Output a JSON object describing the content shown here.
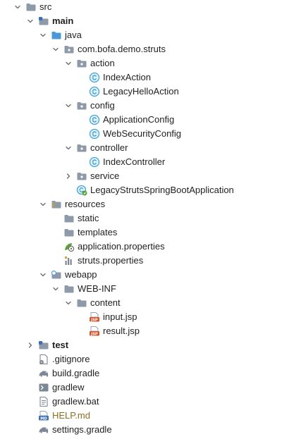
{
  "tree": {
    "items": [
      {
        "label": "src",
        "depth": 0,
        "icon": "folder-icon",
        "chevron": "down"
      },
      {
        "label": "main",
        "depth": 1,
        "icon": "module-folder-icon",
        "chevron": "down",
        "bold": true
      },
      {
        "label": "java",
        "depth": 2,
        "icon": "source-folder-icon",
        "chevron": "down"
      },
      {
        "label": "com.bofa.demo.struts",
        "depth": 3,
        "icon": "package-icon",
        "chevron": "down"
      },
      {
        "label": "action",
        "depth": 4,
        "icon": "package-icon",
        "chevron": "down"
      },
      {
        "label": "IndexAction",
        "depth": 5,
        "icon": "java-class-icon",
        "chevron": "none"
      },
      {
        "label": "LegacyHelloAction",
        "depth": 5,
        "icon": "java-class-icon",
        "chevron": "none"
      },
      {
        "label": "config",
        "depth": 4,
        "icon": "package-icon",
        "chevron": "down"
      },
      {
        "label": "ApplicationConfig",
        "depth": 5,
        "icon": "java-class-icon",
        "chevron": "none"
      },
      {
        "label": "WebSecurityConfig",
        "depth": 5,
        "icon": "java-class-icon",
        "chevron": "none"
      },
      {
        "label": "controller",
        "depth": 4,
        "icon": "package-icon",
        "chevron": "down"
      },
      {
        "label": "IndexController",
        "depth": 5,
        "icon": "java-class-icon",
        "chevron": "none"
      },
      {
        "label": "service",
        "depth": 4,
        "icon": "package-icon",
        "chevron": "right"
      },
      {
        "label": "LegacyStrutsSpringBootApplication",
        "depth": 4,
        "icon": "spring-boot-class-icon",
        "chevron": "none"
      },
      {
        "label": "resources",
        "depth": 2,
        "icon": "resources-folder-icon",
        "chevron": "down"
      },
      {
        "label": "static",
        "depth": 3,
        "icon": "folder-icon",
        "chevron": "none"
      },
      {
        "label": "templates",
        "depth": 3,
        "icon": "folder-icon",
        "chevron": "none"
      },
      {
        "label": "application.properties",
        "depth": 3,
        "icon": "spring-properties-icon",
        "chevron": "none"
      },
      {
        "label": "struts.properties",
        "depth": 3,
        "icon": "properties-file-icon",
        "chevron": "none"
      },
      {
        "label": "webapp",
        "depth": 2,
        "icon": "web-folder-icon",
        "chevron": "down"
      },
      {
        "label": "WEB-INF",
        "depth": 3,
        "icon": "folder-icon",
        "chevron": "down"
      },
      {
        "label": "content",
        "depth": 4,
        "icon": "folder-icon",
        "chevron": "down"
      },
      {
        "label": "input.jsp",
        "depth": 5,
        "icon": "jsp-file-icon",
        "chevron": "none"
      },
      {
        "label": "result.jsp",
        "depth": 5,
        "icon": "jsp-file-icon",
        "chevron": "none"
      },
      {
        "label": "test",
        "depth": 1,
        "icon": "module-folder-icon",
        "chevron": "right",
        "bold": true
      },
      {
        "label": ".gitignore",
        "depth": 1,
        "icon": "gitignore-file-icon",
        "chevron": "none"
      },
      {
        "label": "build.gradle",
        "depth": 1,
        "icon": "gradle-icon",
        "chevron": "none"
      },
      {
        "label": "gradlew",
        "depth": 1,
        "icon": "shell-script-icon",
        "chevron": "none"
      },
      {
        "label": "gradlew.bat",
        "depth": 1,
        "icon": "text-file-icon",
        "chevron": "none"
      },
      {
        "label": "HELP.md",
        "depth": 1,
        "icon": "markdown-file-icon",
        "chevron": "none",
        "muted": true
      },
      {
        "label": "settings.gradle",
        "depth": 1,
        "icon": "gradle-icon",
        "chevron": "none"
      }
    ]
  },
  "icon_glyphs": {
    "jsp": "JSP",
    "md": "MD",
    "class": "C"
  },
  "colors": {
    "folder": "#8f9aa8",
    "java_class": "#40a4d8",
    "module_badge": "#3d6fb5",
    "jsp": "#d3572e",
    "spring": "#5aa23b",
    "muted_text": "#8a6d1f"
  }
}
